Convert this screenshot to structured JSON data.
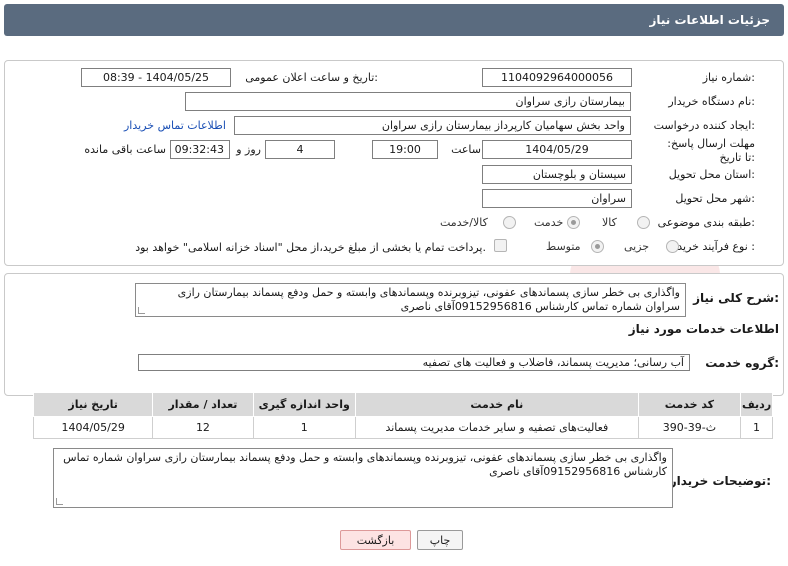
{
  "header": {
    "title": "جزئیات اطلاعات نیاز"
  },
  "fields": {
    "need_number_label": "شماره نیاز:",
    "need_number": "1104092964000056",
    "announce_label": "تاریخ و ساعت اعلان عمومی:",
    "announce_value": "1404/05/25 - 08:39",
    "buyer_org_label": "نام دستگاه خریدار:",
    "buyer_org": "بیمارستان رازی سراوان",
    "creator_label": "ایجاد کننده درخواست:",
    "creator": "واحد بخش  سهامیان کارپرداز بیمارستان رازی سراوان",
    "contact_link": "اطلاعات تماس خریدار",
    "deadline_label": "مهلت ارسال پاسخ: تا تاریخ:",
    "deadline_date": "1404/05/29",
    "time_label": "ساعت",
    "deadline_time": "19:00",
    "days_value": "4",
    "days_label": "روز و",
    "remaining_time": "09:32:43",
    "remaining_label": "ساعت باقی مانده",
    "province_label": "استان محل تحویل:",
    "province": "سیستان و بلوچستان",
    "city_label": "شهر محل تحویل:",
    "city": "سراوان",
    "category_label": "طبقه بندی موضوعی:",
    "category_options": [
      "کالا",
      "خدمت",
      "کالا/خدمت"
    ],
    "process_label": "نوع فرآیند خرید :",
    "process_options": [
      "جزیی",
      "متوسط"
    ],
    "payment_note": "پرداخت تمام یا بخشی از مبلغ خرید،از محل \"اسناد خزانه اسلامی\" خواهد بود."
  },
  "summary": {
    "label": "شرح کلی نیاز:",
    "text": "واگذاری بی خطر سازی پسماندهای عفونی، تیزوبرنده وپسماندهای وابسته و حمل ودفع پسماند بیمارستان رازی سراوان شماره تماس کارشناس 09152956816آقای ناصری"
  },
  "services": {
    "section_title": "اطلاعات خدمات مورد نیاز",
    "group_label": "گروه خدمت:",
    "group_value": "آب رسانی؛ مدیریت پسماند، فاضلاب و فعالیت های تصفیه",
    "columns": [
      "ردیف",
      "کد خدمت",
      "نام خدمت",
      "واحد اندازه گیری",
      "تعداد / مقدار",
      "تاریخ نیاز"
    ],
    "rows": [
      [
        "1",
        "ث-39-390",
        "فعالیت‌های تصفیه و سایر خدمات مدیریت پسماند",
        "1",
        "12",
        "1404/05/29"
      ]
    ]
  },
  "buyer_notes": {
    "label": "توضیحات خریدار:",
    "text": "واگذاری بی خطر سازی پسماندهای عفونی، تیزوبرنده وپسماندهای وابسته و حمل ودفع پسماند بیمارستان رازی سراوان شماره تماس کارشناس 09152956816آقای ناصری"
  },
  "buttons": {
    "print": "چاپ",
    "back": "بازگشت"
  }
}
